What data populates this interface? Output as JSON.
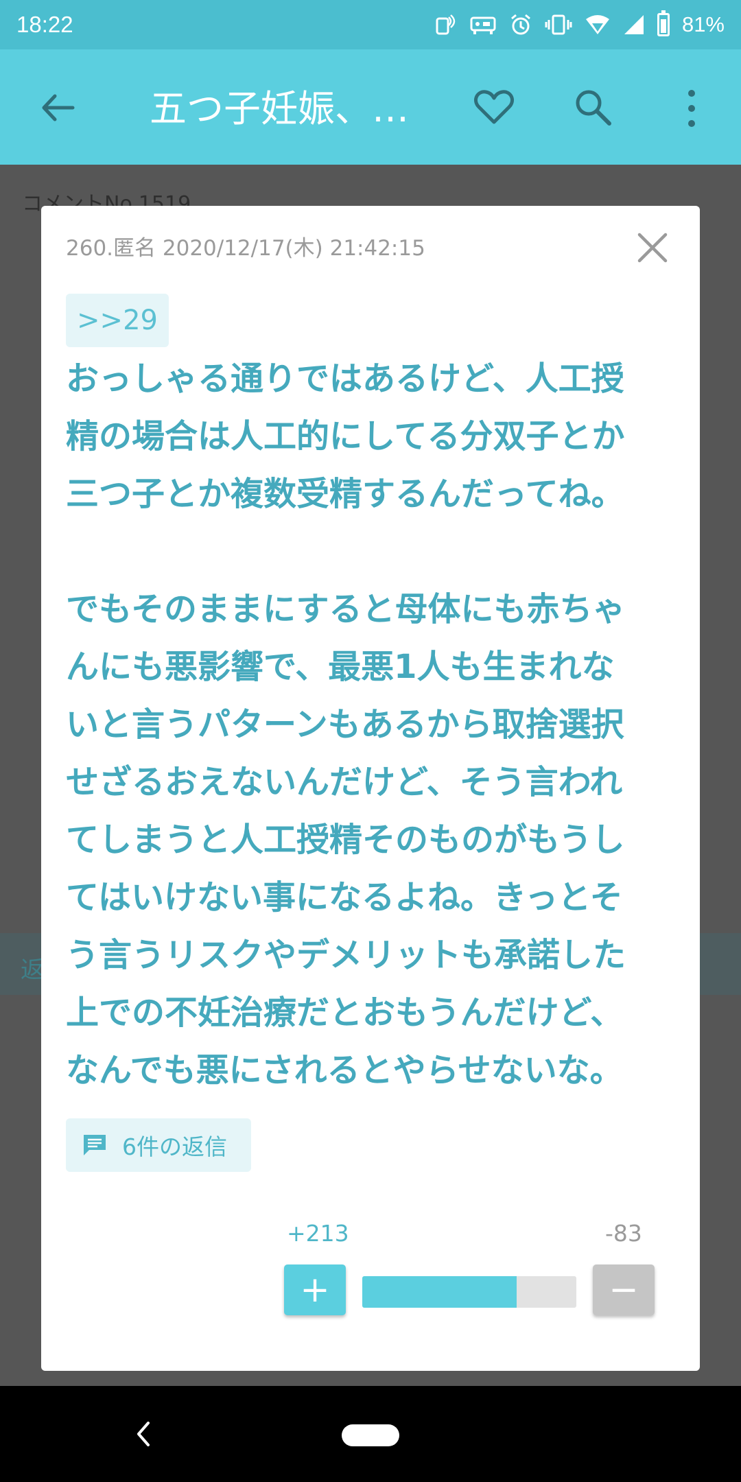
{
  "status_bar": {
    "time": "18:22",
    "battery": "81%"
  },
  "app_bar": {
    "title": "五つ子妊娠、…",
    "icons": [
      "back-arrow-icon",
      "heart-icon",
      "search-icon",
      "more-vert-icon"
    ]
  },
  "background": {
    "comment_no": "コメントNo.1519",
    "reply_strip": "返"
  },
  "dialog": {
    "meta": "260.匿名 2020/12/17(木) 21:42:15",
    "anchor": ">>29",
    "body": "おっしゃる通りではあるけど、人工授\n精の場合は人工的にしてる分双子とか\n三つ子とか複数受精するんだってね。\n\nでもそのままにすると母体にも赤ちゃ\nんにも悪影響で、最悪1人も生まれな\nいと言うパターンもあるから取捨選択\nせざるおえないんだけど、そう言われ\nてしまうと人工授精そのものがもうし\nてはいけない事になるよね。きっとそ\nう言うリスクやデメリットも承諾した\n上での不妊治療だとおもうんだけど、\nなんでも悪にされるとやらせないな。",
    "replies_label": "6件の返信",
    "plus_count": "+213",
    "minus_count": "-83",
    "plus_symbol": "+",
    "minus_symbol": "−",
    "vote_ratio": 0.72
  },
  "colors": {
    "accent": "#5bcfdf",
    "text_accent": "#45a9bd",
    "status_bar": "#4bbecf"
  }
}
